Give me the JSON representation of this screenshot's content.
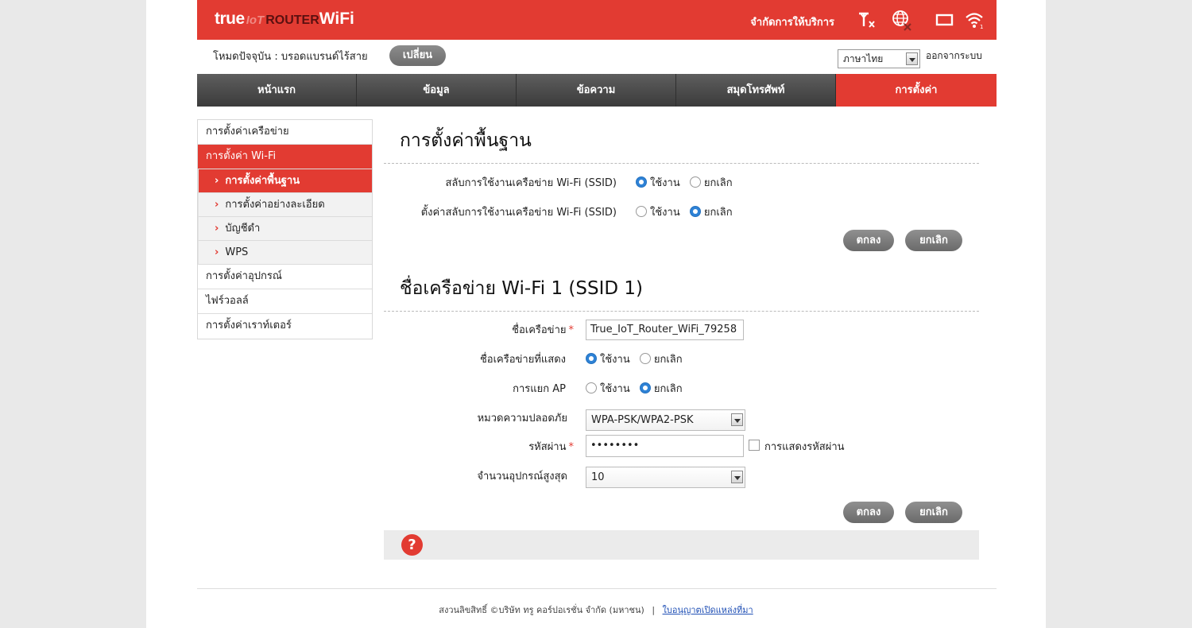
{
  "header": {
    "brand_true": "true",
    "brand_iot": "IoT",
    "brand_router": "ROUTER",
    "brand_wifi": "WiFi",
    "service_limit": "จำกัดการให้บริการ",
    "icons": [
      "signal-x-icon",
      "globe-disconnected-icon",
      "battery-icon",
      "wifi-icon"
    ],
    "accent_color": "#e23b32"
  },
  "mode": {
    "label": "โหมดปัจจุบัน : บรอดแบรนด์ไร้สาย",
    "change_button": "เปลี่ยน"
  },
  "language": {
    "selected": "ภาษาไทย"
  },
  "logout": "ออกจากระบบ",
  "nav": {
    "items": [
      "หน้าแรก",
      "ข้อมูล",
      "ข้อความ",
      "สมุดโทรศัพท์",
      "การตั้งค่า"
    ],
    "active": "การตั้งค่า"
  },
  "sidebar": {
    "network": "การตั้งค่าเครือข่าย",
    "wifi": "การตั้งค่า Wi-Fi",
    "sub": [
      "การตั้งค่าพื้นฐาน",
      "การตั้งค่าอย่างละเอียด",
      "บัญชีดำ",
      "WPS"
    ],
    "device": "การตั้งค่าอุปกรณ์",
    "firewall": "ไฟร์วอลล์",
    "router": "การตั้งค่าเราท์เตอร์"
  },
  "basic": {
    "title": "การตั้งค่าพื้นฐาน",
    "ssid_switch_label": "สลับการใช้งานเครือข่าย Wi-Fi (SSID)",
    "ssid_switch_set_label": "ตั้งค่าสลับการใช้งานเครือข่าย Wi-Fi (SSID)",
    "enable": "ใช้งาน",
    "cancel": "ยกเลิก",
    "ok_button": "ตกลง",
    "cancel_button": "ยกเลิก"
  },
  "ssid1": {
    "title": "ชื่อเครือข่าย Wi-Fi 1 (SSID 1)",
    "network_name_label": "ชื่อเครือข่าย",
    "network_name_value": "True_IoT_Router_WiFi_79258",
    "broadcast_label": "ชื่อเครือข่ายที่แสดง",
    "ap_isolation_label": "การแยก AP",
    "security_label": "หมวดความปลอดภัย",
    "security_value": "WPA-PSK/WPA2-PSK",
    "password_label": "รหัสผ่าน",
    "password_value": "••••••••",
    "show_password_label": "การแสดงรหัสผ่าน",
    "max_devices_label": "จำนวนอุปกรณ์สูงสุด",
    "max_devices_value": "10",
    "enable": "ใช้งาน",
    "cancel": "ยกเลิก",
    "ok_button": "ตกลง",
    "cancel_button": "ยกเลิก",
    "required_mark": "*"
  },
  "help": {
    "symbol": "?"
  },
  "footer": {
    "copyright": "สงวนลิขสิทธิ์ ©บริษัท ทรู คอร์ปอเรชั่น จำกัด (มหาชน)",
    "separator": "|",
    "license_link": "ใบอนุญาตเปิดแหล่งที่มา"
  }
}
